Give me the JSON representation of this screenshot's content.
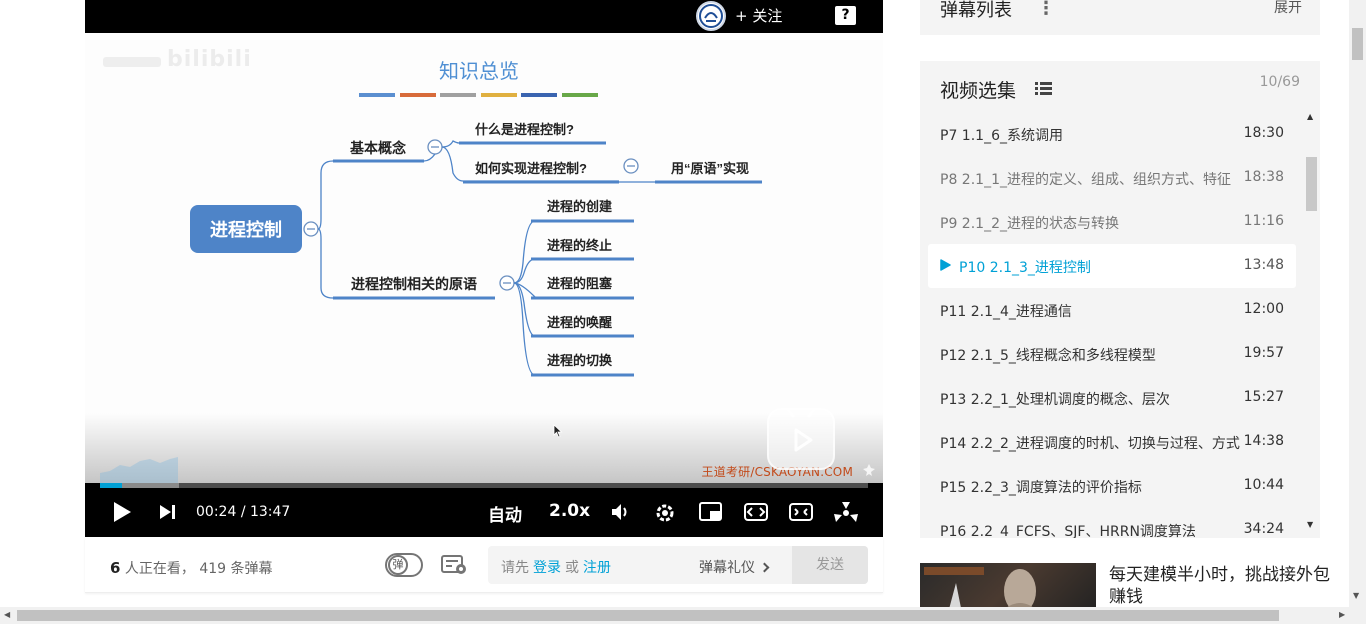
{
  "player": {
    "follow_label": "+ 关注",
    "help_label": "?",
    "watermark": "bilibili",
    "slide": {
      "title": "知识总览",
      "root": "进程控制",
      "branch1": "基本概念",
      "branch1_children": [
        "什么是进程控制?",
        "如何实现进程控制?"
      ],
      "primitive_label": "用“原语”实现",
      "branch2": "进程控制相关的原语",
      "branch2_children": [
        "进程的创建",
        "进程的终止",
        "进程的阻塞",
        "进程的唤醒",
        "进程的切换"
      ],
      "color_bar": [
        "#5b8fd0",
        "#d86b3a",
        "#a0a0a0",
        "#e0b040",
        "#3a64b0",
        "#68a848"
      ]
    },
    "video_watermark": "王道考研/CSKAOYAN.COM",
    "progress_fraction": 0.029,
    "buffer_fraction": 0.103,
    "current_time": "00:24",
    "time_separator": "/",
    "total_time": "13:47",
    "quality_label": "自动",
    "speed_label": "2.0x",
    "accent": "#00a1d6"
  },
  "below": {
    "viewer_count": "6",
    "viewer_text": "人正在看，",
    "danmaku_count_text": "419 条弹幕",
    "danmaku_toggle_label": "弹",
    "send_hint_prefix": "请先",
    "login_label": "登录",
    "or_label": "或",
    "register_label": "注册",
    "etiquette_label": "弹幕礼仪",
    "send_label": "发送"
  },
  "danmaku_list": {
    "title": "弹幕列表",
    "expand_label": "展开"
  },
  "episodes": {
    "title": "视频选集",
    "count": "10/69",
    "items": [
      {
        "label": "P7   1.1_6_系统调用",
        "duration": "18:30"
      },
      {
        "label": "P8   2.1_1_进程的定义、组成、组织方式、特征",
        "duration": "18:38"
      },
      {
        "label": "P9   2.1_2_进程的状态与转换",
        "duration": "11:16"
      },
      {
        "label": "P10   2.1_3_进程控制",
        "duration": "13:48"
      },
      {
        "label": "P11   2.1_4_进程通信",
        "duration": "12:00"
      },
      {
        "label": "P12   2.1_5_线程概念和多线程模型",
        "duration": "19:57"
      },
      {
        "label": "P13   2.2_1_处理机调度的概念、层次",
        "duration": "15:27"
      },
      {
        "label": "P14   2.2_2_进程调度的时机、切换与过程、方式",
        "duration": "14:38"
      },
      {
        "label": "P15   2.2_3_调度算法的评价指标",
        "duration": "10:44"
      },
      {
        "label": "P16   2.2_4_FCFS、SJF、HRRN调度算法",
        "duration": "34:24"
      }
    ]
  },
  "recommend": {
    "title": "每天建模半小时，挑战接外包赚钱"
  }
}
